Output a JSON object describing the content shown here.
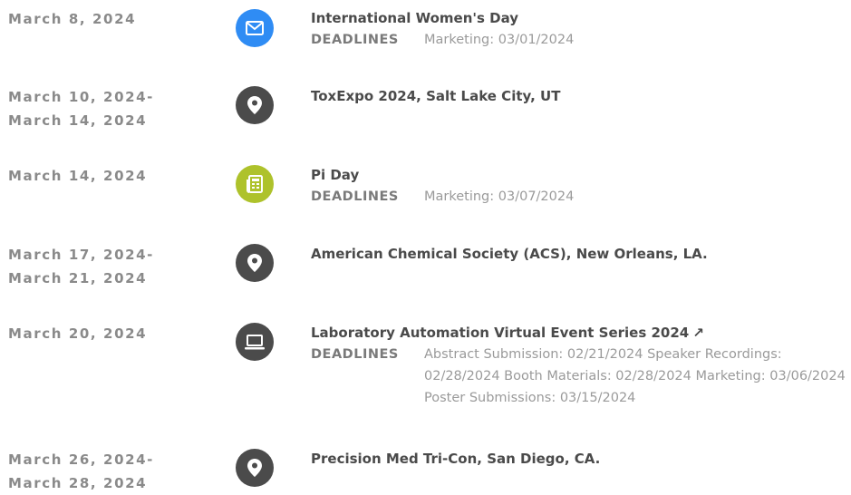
{
  "colors": {
    "blue": "#2f8cf4",
    "gray": "#4b4b4b",
    "green": "#aec22b"
  },
  "events": [
    {
      "date1": "March 8, 2024",
      "date2": "",
      "icon": "mail-icon",
      "title": "International Women's Day",
      "deadlines_label": "DEADLINES",
      "deadlines": "Marketing: 03/01/2024"
    },
    {
      "date1": "March 10, 2024-",
      "date2": "March 14, 2024",
      "icon": "location-pin-icon",
      "title": "ToxExpo 2024, Salt Lake City, UT"
    },
    {
      "date1": "March 14, 2024",
      "date2": "",
      "icon": "newspaper-icon",
      "title": "Pi Day",
      "deadlines_label": "DEADLINES",
      "deadlines": "Marketing: 03/07/2024"
    },
    {
      "date1": "March 17, 2024-",
      "date2": "March 21, 2024",
      "icon": "location-pin-icon",
      "title": "American Chemical Society (ACS), New Orleans, LA."
    },
    {
      "date1": "March 20, 2024",
      "date2": "",
      "icon": "laptop-icon",
      "title": "Laboratory Automation Virtual Event Series 2024",
      "external_icon": "↗",
      "deadlines_label": "DEADLINES",
      "deadlines": "Abstract Submission: 02/21/2024 Speaker Recordings: 02/28/2024 Booth Materials: 02/28/2024 Marketing: 03/06/2024 Poster Submissions: 03/15/2024"
    },
    {
      "date1": "March 26, 2024-",
      "date2": "March 28, 2024",
      "icon": "location-pin-icon",
      "title": "Precision Med Tri-Con, San Diego, CA."
    }
  ]
}
